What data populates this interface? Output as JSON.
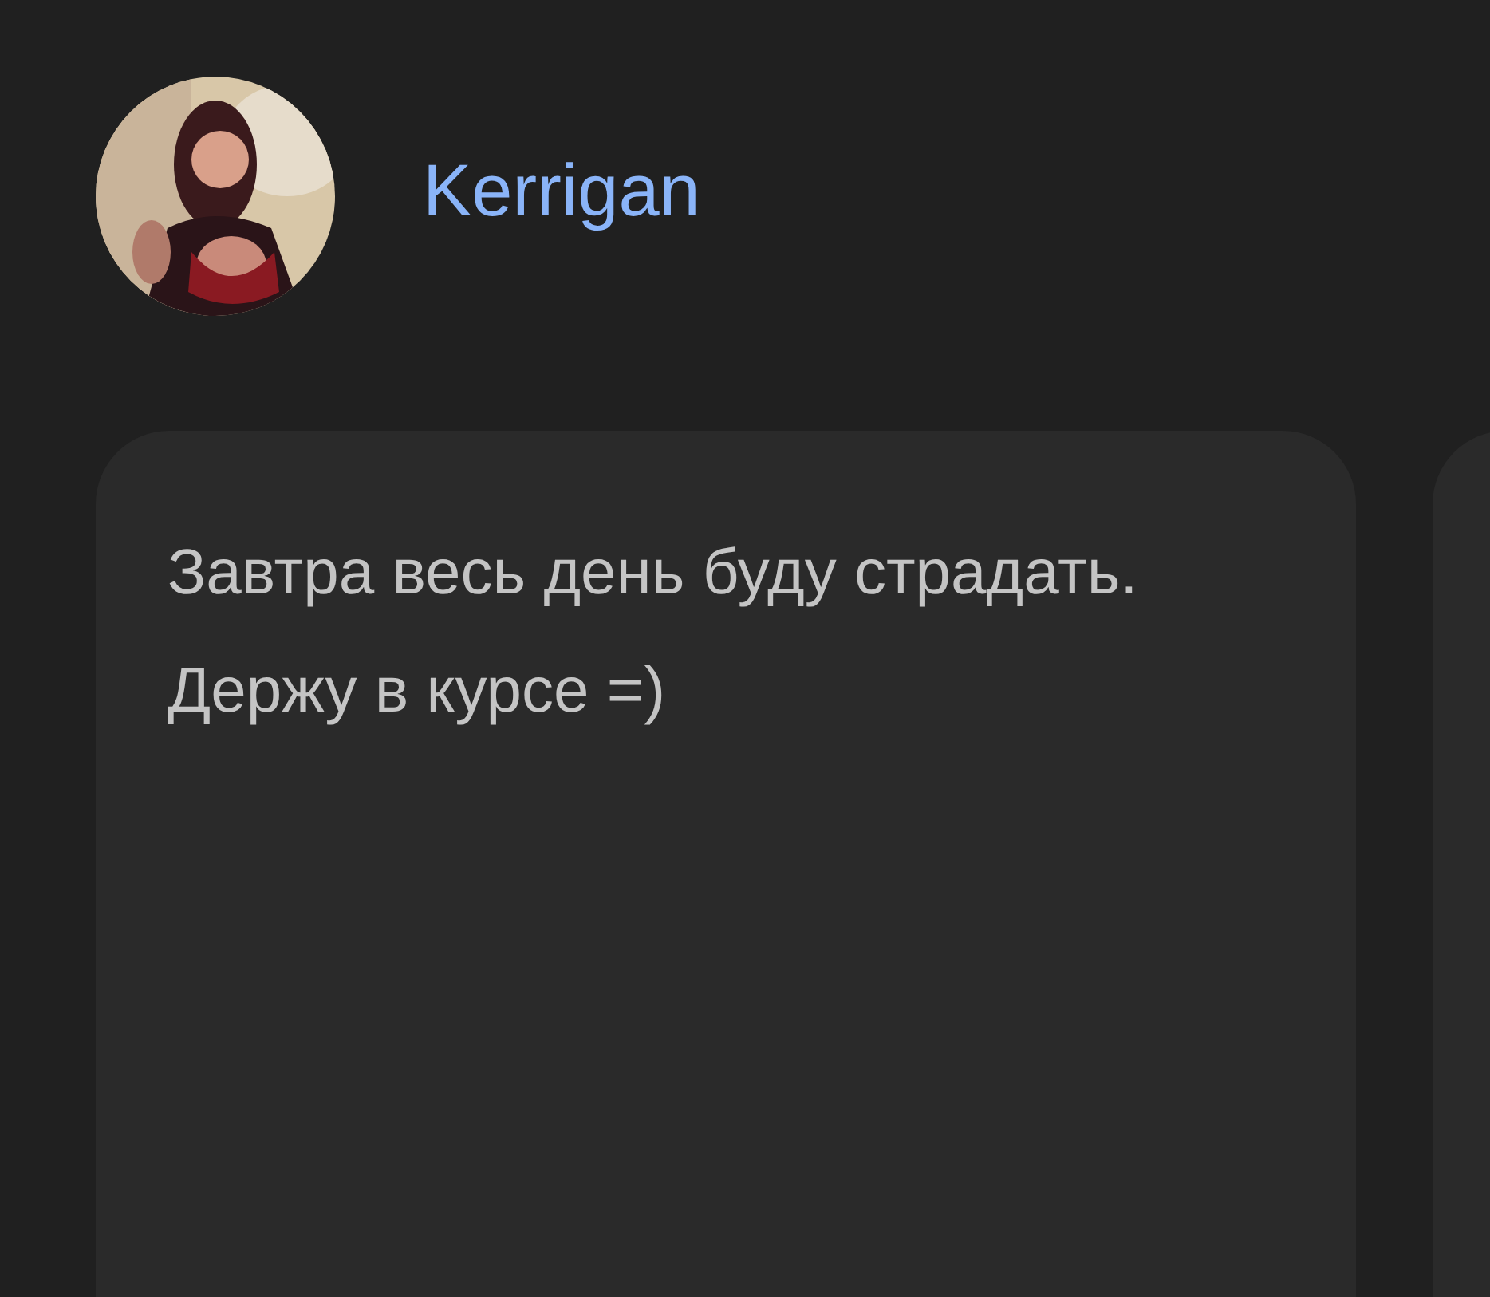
{
  "author": {
    "name": "Kerrigan"
  },
  "cards": [
    {
      "kind": "text",
      "text": "Завтра весь день буду страдать. Держу в курсе =)"
    },
    {
      "kind": "empty"
    }
  ]
}
